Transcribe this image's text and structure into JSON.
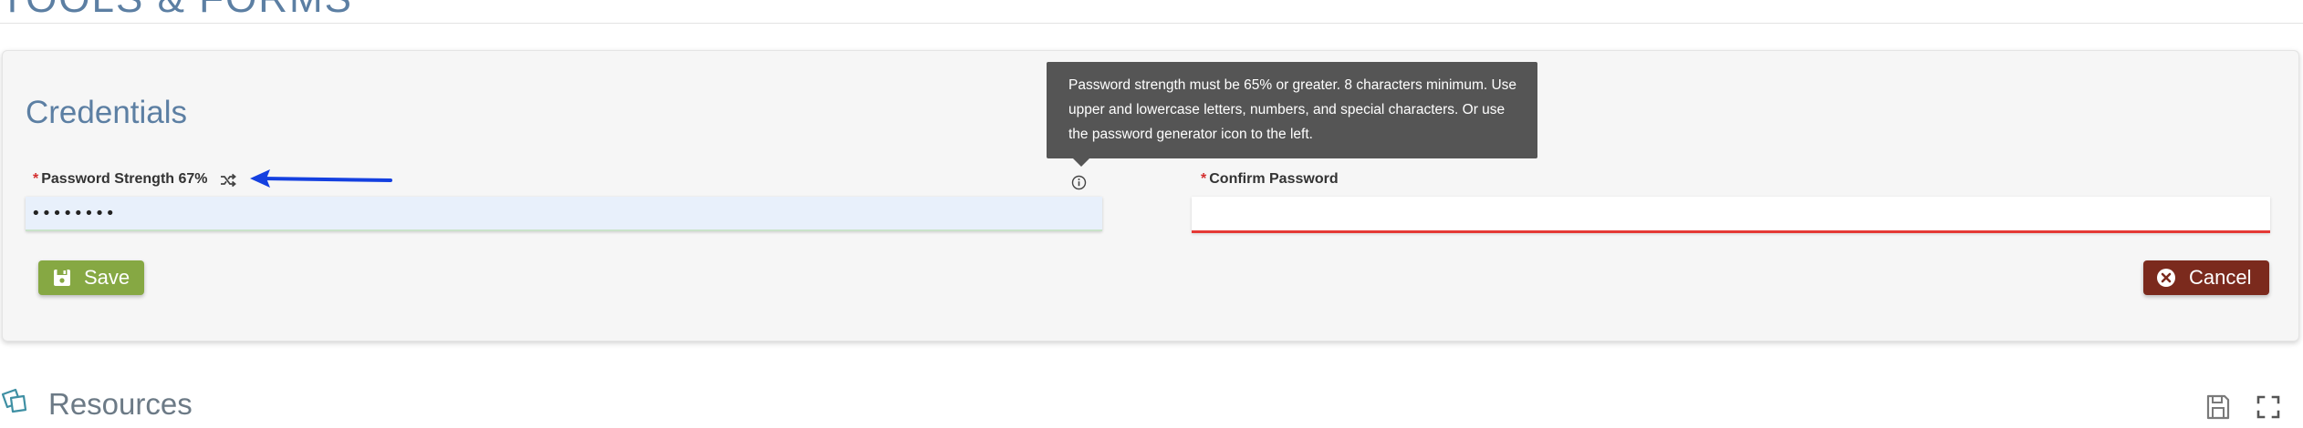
{
  "section_title": "TOOLS & FORMS",
  "credentials": {
    "title": "Credentials",
    "password_label": "Password Strength 67%",
    "password_value": "••••••••",
    "confirm_label": "Confirm Password",
    "confirm_value": "",
    "required_marker": "*",
    "save_label": "Save",
    "cancel_label": "Cancel",
    "tooltip": "Password strength must be 65% or greater. 8 characters minimum. Use upper and lowercase letters, numbers, and special characters. Or use the password generator icon to the left."
  },
  "resources": {
    "title": "Resources"
  },
  "icons": {
    "shuffle": "password-generator-icon",
    "info": "info-icon",
    "save": "floppy-disk-icon",
    "cancel": "x-circle-icon",
    "resources": "documents-icon",
    "expand": "fullscreen-icon"
  },
  "colors": {
    "heading_blue": "#5c7fa3",
    "save_green": "#86a843",
    "cancel_red": "#7b2a1d",
    "error_underline": "#e53935",
    "annotation_arrow": "#1440e0",
    "tooltip_bg": "#555555"
  }
}
